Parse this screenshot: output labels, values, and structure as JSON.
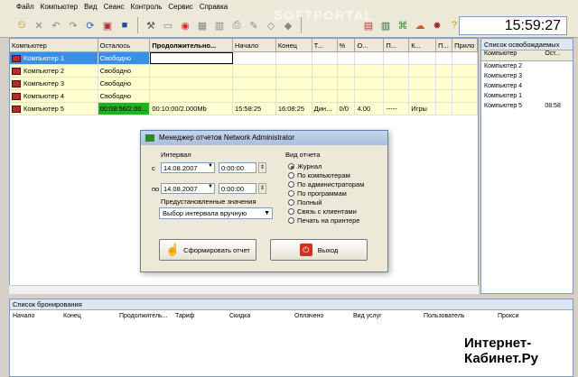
{
  "menu": [
    "Файл",
    "Компьютер",
    "Вид",
    "Сеанс",
    "Контроль",
    "Сервис",
    "Справка"
  ],
  "clock": "15:59:27",
  "watermark": "SOFTPORTAL",
  "grid": {
    "headers": [
      "Компьютер",
      "Осталось",
      "Продолжительно...",
      "Начало",
      "Конец",
      "Т...",
      "%",
      "О...",
      "П...",
      "К...",
      "П...",
      "Прило"
    ],
    "rows": [
      {
        "name": "Компьютер 1",
        "left": "Свободно",
        "duration": "",
        "start": "",
        "end": "",
        "tariff": "",
        "pct": "",
        "amount": "",
        "p": "",
        "k": "",
        "app": ""
      },
      {
        "name": "Компьютер 2",
        "left": "Свободно",
        "duration": "",
        "start": "",
        "end": "",
        "tariff": "",
        "pct": "",
        "amount": "",
        "p": "",
        "k": "",
        "app": ""
      },
      {
        "name": "Компьютер 3",
        "left": "Свободно",
        "duration": "",
        "start": "",
        "end": "",
        "tariff": "",
        "pct": "",
        "amount": "",
        "p": "",
        "k": "",
        "app": ""
      },
      {
        "name": "Компьютер 4",
        "left": "Свободно",
        "duration": "",
        "start": "",
        "end": "",
        "tariff": "",
        "pct": "",
        "amount": "",
        "p": "",
        "k": "",
        "app": ""
      },
      {
        "name": "Компьютер 5",
        "left": "00:08:56/2.00...",
        "duration": "00:10:00/2.000Mb",
        "start": "15:58:25",
        "end": "16:08:25",
        "tariff": "Дин...",
        "pct": "0/0",
        "amount": "4.00",
        "p": "-----",
        "k": "Игры",
        "app": ""
      }
    ]
  },
  "free_list": {
    "title": "Список освобождаемых",
    "headers": [
      "Компьютер",
      "Ост..."
    ],
    "rows": [
      {
        "name": "Компьютер 2",
        "left": ""
      },
      {
        "name": "Компьютер 3",
        "left": ""
      },
      {
        "name": "Компьютер 4",
        "left": ""
      },
      {
        "name": "Компьютер 1",
        "left": ""
      },
      {
        "name": "Компьютер 5",
        "left": "08:58"
      }
    ]
  },
  "booking": {
    "title": "Список бронирования",
    "headers": [
      "Начало",
      "Конец",
      "Продолжитель...",
      "Тариф",
      "Скидка",
      "Оплачено",
      "Вид услуг",
      "Пользователь",
      "Прокси"
    ]
  },
  "dialog": {
    "title": "Менеджер отчетов Network Administrator",
    "interval_label": "Интервал",
    "from_label": "с",
    "from_date": "14.08.2007",
    "from_time": "0:00:00",
    "to_label": "по",
    "to_date": "14.08.2007",
    "to_time": "0:00:00",
    "preset_label": "Предустановленные значения",
    "preset_value": "Выбор интервала вручную",
    "report_type_label": "Вид отчета",
    "report_types": [
      "Журнал",
      "По компьютерам",
      "По администраторам",
      "По программам",
      "Полный",
      "Связь с клиентами",
      "Печать на принтере"
    ],
    "selected_type": 0,
    "generate_button": "Сформировать отчет",
    "exit_button": "Выход"
  },
  "brand": {
    "line1": "Интернет-",
    "line2": "Кабинет.Ру"
  }
}
